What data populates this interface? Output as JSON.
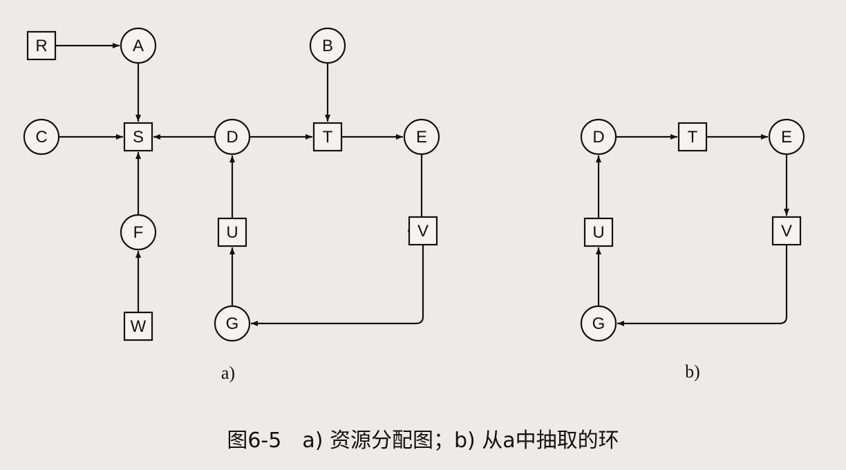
{
  "diagram": {
    "panels": [
      {
        "id": "a",
        "label": "a)",
        "nodes": [
          {
            "id": "a-R",
            "label": "R",
            "kind": "resource"
          },
          {
            "id": "a-A",
            "label": "A",
            "kind": "process"
          },
          {
            "id": "a-B",
            "label": "B",
            "kind": "process"
          },
          {
            "id": "a-C",
            "label": "C",
            "kind": "process"
          },
          {
            "id": "a-S",
            "label": "S",
            "kind": "resource"
          },
          {
            "id": "a-D",
            "label": "D",
            "kind": "process"
          },
          {
            "id": "a-T",
            "label": "T",
            "kind": "resource"
          },
          {
            "id": "a-E",
            "label": "E",
            "kind": "process"
          },
          {
            "id": "a-F",
            "label": "F",
            "kind": "process"
          },
          {
            "id": "a-U",
            "label": "U",
            "kind": "resource"
          },
          {
            "id": "a-V",
            "label": "V",
            "kind": "resource"
          },
          {
            "id": "a-W",
            "label": "W",
            "kind": "resource"
          },
          {
            "id": "a-G",
            "label": "G",
            "kind": "process"
          }
        ],
        "edges": [
          {
            "from": "a-R",
            "to": "a-A"
          },
          {
            "from": "a-A",
            "to": "a-S"
          },
          {
            "from": "a-C",
            "to": "a-S"
          },
          {
            "from": "a-D",
            "to": "a-S"
          },
          {
            "from": "a-D",
            "to": "a-T"
          },
          {
            "from": "a-B",
            "to": "a-T"
          },
          {
            "from": "a-T",
            "to": "a-E"
          },
          {
            "from": "a-E",
            "to": "a-V"
          },
          {
            "from": "a-V",
            "to": "a-G"
          },
          {
            "from": "a-G",
            "to": "a-U"
          },
          {
            "from": "a-U",
            "to": "a-D"
          },
          {
            "from": "a-F",
            "to": "a-S"
          },
          {
            "from": "a-W",
            "to": "a-F"
          }
        ]
      },
      {
        "id": "b",
        "label": "b)",
        "nodes": [
          {
            "id": "b-D",
            "label": "D",
            "kind": "process"
          },
          {
            "id": "b-T",
            "label": "T",
            "kind": "resource"
          },
          {
            "id": "b-E",
            "label": "E",
            "kind": "process"
          },
          {
            "id": "b-U",
            "label": "U",
            "kind": "resource"
          },
          {
            "id": "b-V",
            "label": "V",
            "kind": "resource"
          },
          {
            "id": "b-G",
            "label": "G",
            "kind": "process"
          }
        ],
        "edges": [
          {
            "from": "b-D",
            "to": "b-T"
          },
          {
            "from": "b-T",
            "to": "b-E"
          },
          {
            "from": "b-E",
            "to": "b-V"
          },
          {
            "from": "b-V",
            "to": "b-G"
          },
          {
            "from": "b-G",
            "to": "b-U"
          },
          {
            "from": "b-U",
            "to": "b-D"
          }
        ]
      }
    ]
  },
  "caption": "图6-5　a) 资源分配图；b) 从a中抽取的环"
}
